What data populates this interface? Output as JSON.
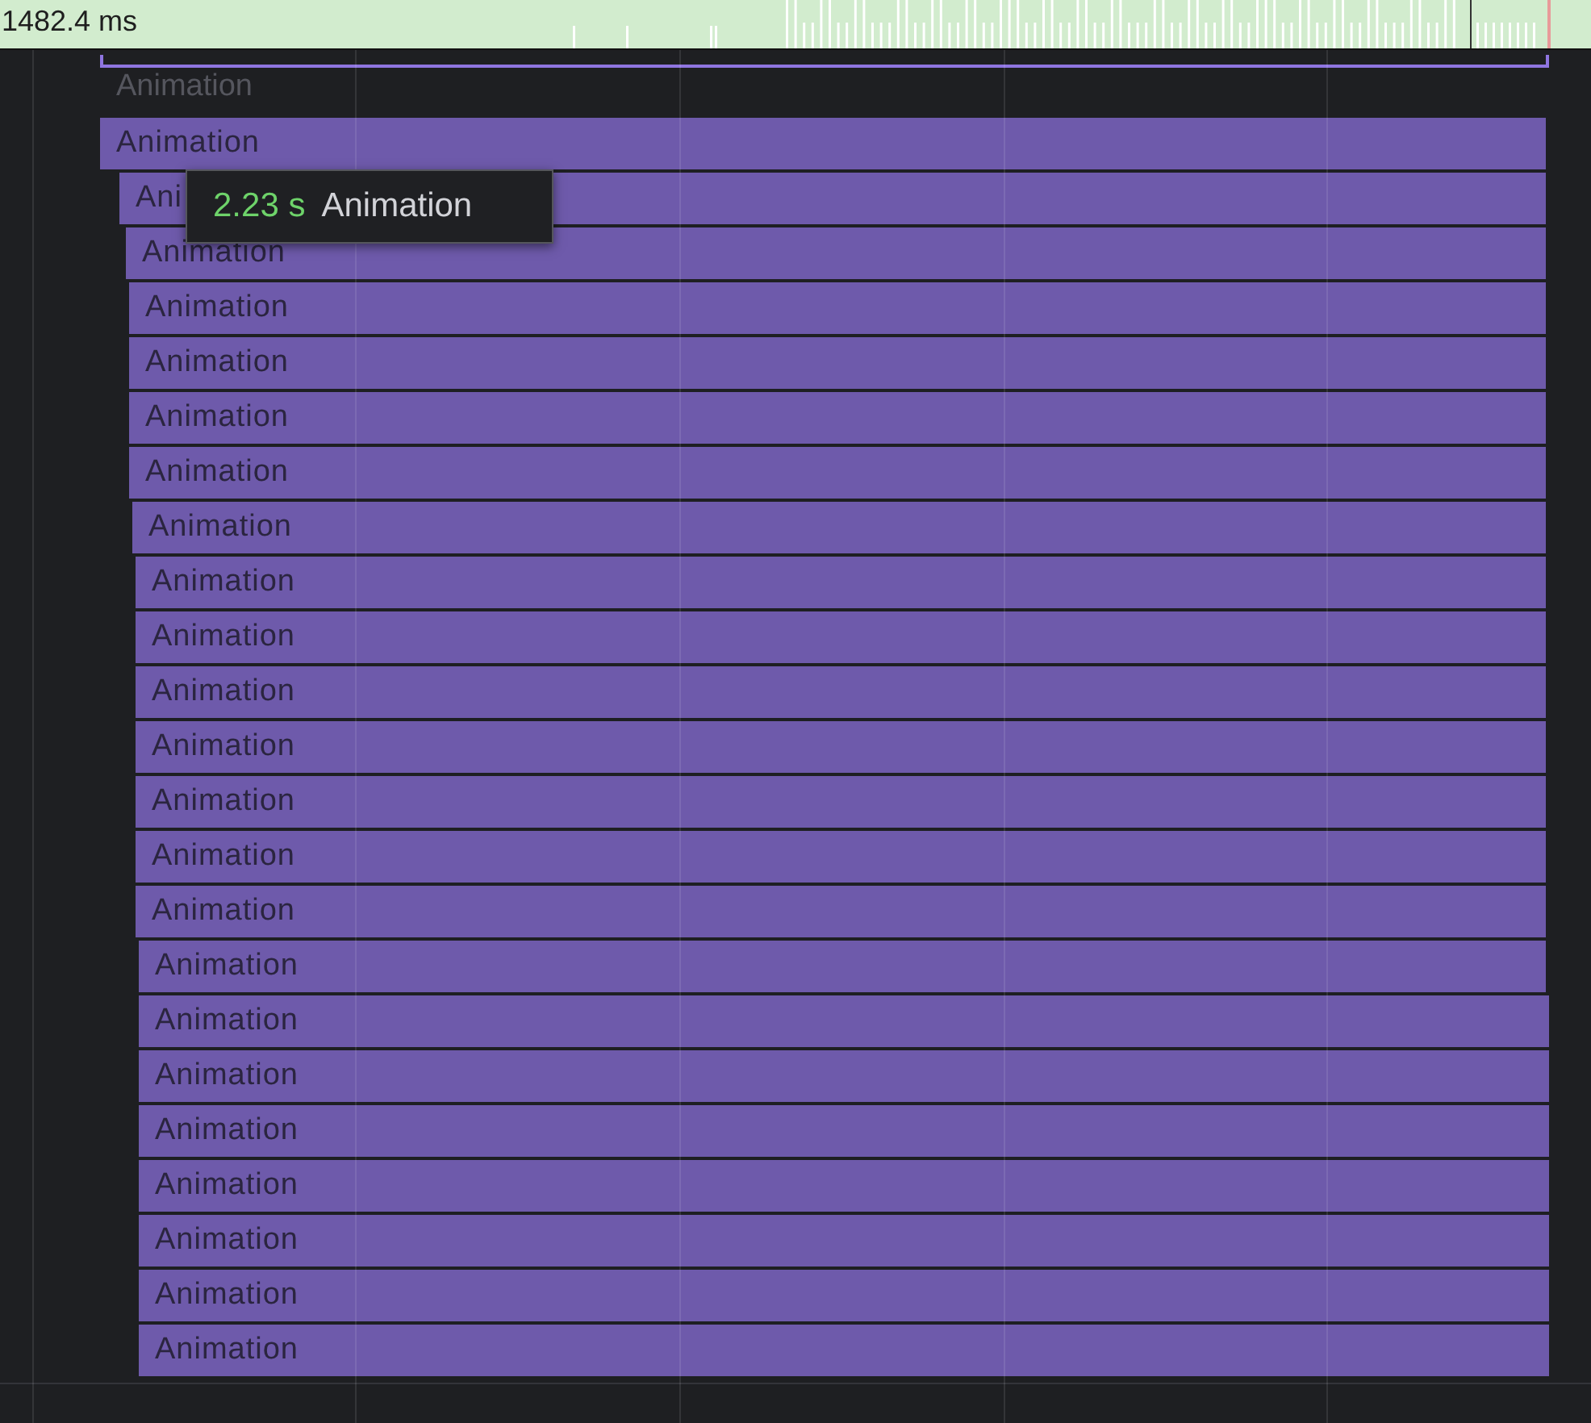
{
  "overview": {
    "time_label": "1482.4 ms"
  },
  "group": {
    "label": "Animation"
  },
  "rows": [
    {
      "label": "Animation"
    },
    {
      "label": "Ani"
    },
    {
      "label": "Animation"
    },
    {
      "label": "Animation"
    },
    {
      "label": "Animation"
    },
    {
      "label": "Animation"
    },
    {
      "label": "Animation"
    },
    {
      "label": "Animation"
    },
    {
      "label": "Animation"
    },
    {
      "label": "Animation"
    },
    {
      "label": "Animation"
    },
    {
      "label": "Animation"
    },
    {
      "label": "Animation"
    },
    {
      "label": "Animation"
    },
    {
      "label": "Animation"
    },
    {
      "label": "Animation"
    },
    {
      "label": "Animation"
    },
    {
      "label": "Animation"
    },
    {
      "label": "Animation"
    },
    {
      "label": "Animation"
    },
    {
      "label": "Animation"
    },
    {
      "label": "Animation"
    },
    {
      "label": "Animation"
    }
  ],
  "tooltip": {
    "duration": "2.23 s",
    "name": "Animation"
  }
}
